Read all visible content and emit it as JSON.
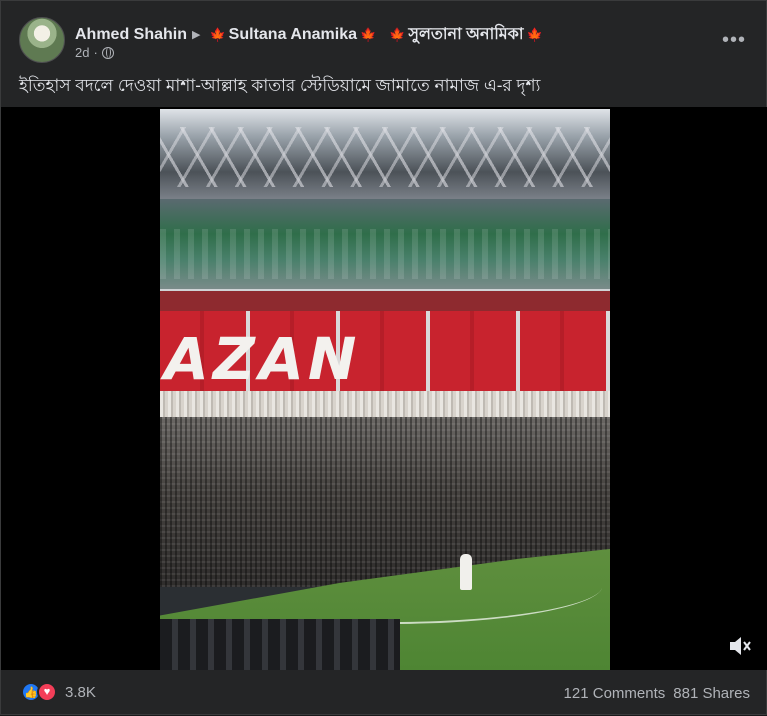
{
  "post": {
    "author": "Ahmed Shahin",
    "target_name_1": "Sultana Anamika",
    "target_name_2": "সুলতানা অনামিকা",
    "time": "2d",
    "caption": "ইতিহাস বদলে দেওয়া মাশা-আল্লাহ কাতার স্টেডিয়ামে জামাতে নামাজ এ-র দৃশ্য"
  },
  "video": {
    "scene_text": "AZAN"
  },
  "footer": {
    "reaction_count": "3.8K",
    "comments": "121 Comments",
    "shares": "881 Shares"
  },
  "icons": {
    "leaf": "maple-leaf-icon",
    "arrow": "triangle-right-icon",
    "privacy": "globe-icon",
    "more": "more-dots-icon",
    "mute": "speaker-muted-icon",
    "like": "thumbs-up-icon",
    "love": "heart-icon"
  },
  "colors": {
    "background": "#242526",
    "text": "#e4e6eb",
    "secondary": "#b0b3b8",
    "like": "#2078f4",
    "love": "#f33e58"
  }
}
